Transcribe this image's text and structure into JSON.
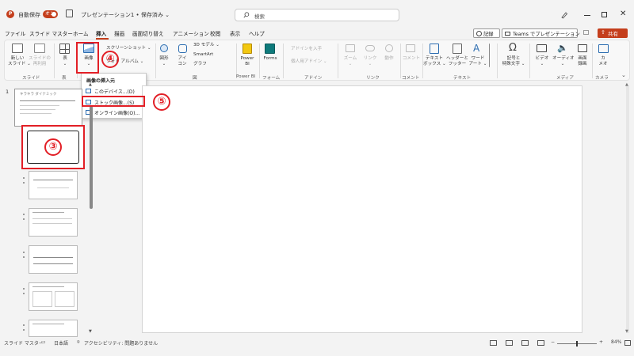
{
  "titlebar": {
    "autosave_label": "自動保存",
    "autosave_state": "オン",
    "file_title": "プレゼンテーション1 • 保存済み ⌄",
    "search_placeholder": "検索"
  },
  "menu": {
    "items": [
      "ファイル",
      "スライド マスター",
      "ホーム",
      "挿入",
      "描画",
      "画面切り替え",
      "アニメーション",
      "校閲",
      "表示",
      "ヘルプ"
    ],
    "active": "挿入",
    "record_label": "記録",
    "teams_label": "Teams でプレゼンテーション",
    "share_label": "共有"
  },
  "ribbon": {
    "new_slide": "新しい\nスライド ⌄",
    "reuse_slide": "スライドの\n再利用",
    "table": "表\n⌄",
    "image": "画像\n⌄",
    "screenshot": "スクリーンショット ⌄",
    "album": "フォト アルバム ⌄",
    "shapes": "図形\n⌄",
    "icons": "アイ\nコン",
    "model3d": "3D モデル ⌄",
    "smartart": "SmartArt",
    "graph": "グラフ",
    "powerbi": "Power\nBI",
    "forms": "Forms",
    "addins": "アドインを入手",
    "my_addins": "個人用アドイン ⌄",
    "zoom": "ズーム\n⌄",
    "link": "リンク\n⌄",
    "action": "動作",
    "comment": "コメント",
    "textbox": "テキスト\nボックス ⌄",
    "header_footer": "ヘッダーと\nフッター",
    "wordart": "ワード\nアート ⌄",
    "symbols": "記号と\n特殊文字 ⌄",
    "video": "ビデオ\n⌄",
    "audio": "オーディオ\n⌄",
    "screen_record": "画面\n録画",
    "camera": "カ\nメオ",
    "groups": {
      "slide": "スライド",
      "table": "表",
      "image": "画",
      "illust": "図",
      "powerbi": "Power BI",
      "forms": "フォーム",
      "addin": "アドイン",
      "link": "リンク",
      "comment": "コメント",
      "text": "テキスト",
      "media": "メディア",
      "camera": "カメラ"
    }
  },
  "dropdown": {
    "header": "画像の挿入元",
    "items": [
      "このデバイス...(D)",
      "ストック画像...(S)",
      "オンライン画像(O)..."
    ]
  },
  "annotations": [
    "③",
    "④",
    "⑤"
  ],
  "thumbs": {
    "numbers": [
      "1"
    ],
    "first_title": "キラキラ ダイナミック"
  },
  "statusbar": {
    "view": "スライド マスター",
    "language": "日本語",
    "accessibility": "アクセシビリティ: 問題ありません",
    "zoom": "84%"
  },
  "colors": {
    "accent": "#c43e1c",
    "annotation": "#e21f26"
  }
}
